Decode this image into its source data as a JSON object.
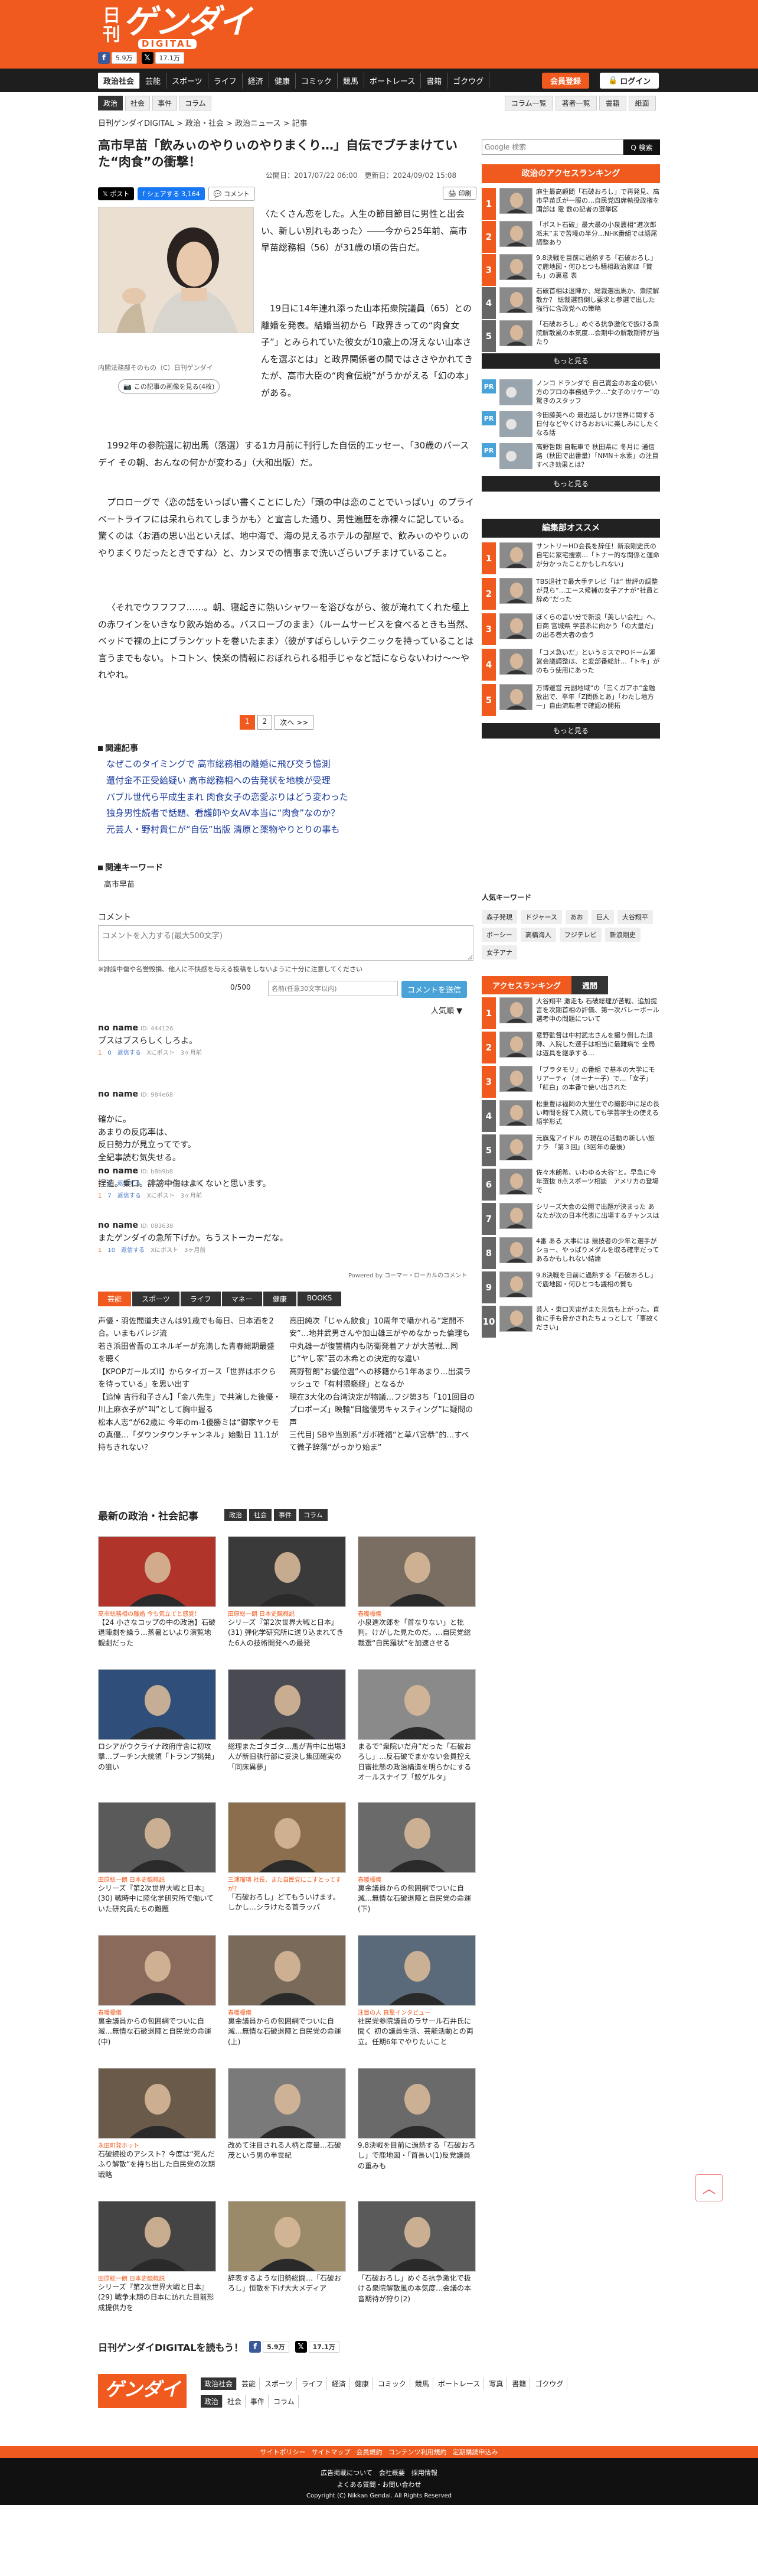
{
  "header": {
    "logo_kanji": "日刊",
    "logo_main": "ゲンダイ",
    "logo_sub": "DIGITAL",
    "fb_count": "5.9万",
    "x_count": "17.1万"
  },
  "nav": {
    "items": [
      "政治社会",
      "芸能",
      "スポーツ",
      "ライフ",
      "経済",
      "健康",
      "コミック",
      "競馬",
      "ボートレース",
      "書籍",
      "ゴクウグ"
    ],
    "member": "会員登録",
    "login": "ログイン"
  },
  "subnav": {
    "items": [
      "政治",
      "社会",
      "事件",
      "コラム"
    ],
    "right": [
      "コラム一覧",
      "著者一覧",
      "書籍",
      "紙面"
    ]
  },
  "breadcrumb": "日刊ゲンダイDIGITAL > 政治・社会 > 政治ニュース > 記事",
  "article": {
    "title": "高市早苗「飲みぃのやりぃのやりまくり…」自伝でブチまけていた“肉食”の衝撃！",
    "date": "公開日：2017/07/22 06:00　更新日：2024/09/02 15:08",
    "share": {
      "x": "ポスト",
      "fb": "シェアする 3,164",
      "comment": "コメント",
      "print": "印刷"
    },
    "caption": "内閣法務部そのもの（C）日刊ゲンダイ",
    "more_images": "この記事の画像を見る(4枚)",
    "p1": "〈たくさん恋をした。人生の節目節目に男性と出会い、新しい別れもあった〉――今から25年前、高市早苗総務相（56）が31歳の頃の告白だ。",
    "p2": "19日に14年連れ添った山本拓衆院議員（65）との離婚を発表。結婚当初から「政界きっての“肉食女子”」とみられていた彼女が10歳上の冴えない山本さんを選ぶとは」と政界関係者の間ではささやかれてきたが、高市大臣の“肉食伝説”がうかがえる「幻の本」がある。",
    "p3": "1992年の参院選に初出馬（落選）する1カ月前に刊行した自伝的エッセー、「30歳のバースデイ その朝、おんなの何かが変わる」（大和出版）だ。",
    "p4": "プロローグで〈恋の話をいっぱい書くことにした〉「頭の中は恋のことでいっぱい」のプライベートライフには呆れられてしまうかも〉と宣言した通り、男性遍歴を赤裸々に記している。驚くのは〈お酒の思い出といえば、地中海で、海の見えるホテルの部屋で、飲みぃのやりぃのやりまくりだったときですね〉と、カンヌでの情事まで洗いざらいブチまけていること。",
    "p5": "〈それでウフフフフ……。朝、寝起きに熱いシャワーを浴びながら、彼が淹れてくれた極上の赤ワインをいきなり飲み始める。バスローブのまま〉（ルームサービスを食べるときも当然、ベッドで裸の上にブランケットを巻いたまま〉（彼がすばらしいテクニックを持っていることは言うまでもない。トコトン、快楽の情報におぼれられる相手じゃなど話にならないわけ〜〜やれやれ。",
    "pages": [
      "1",
      "2",
      "次へ >>"
    ]
  },
  "related": {
    "heading": "関連記事",
    "items": [
      "なぜこのタイミングで 高市総務相の離婚に飛び交う憶測",
      "還付金不正受給疑い 高市総務相への告発状を地検が受理",
      "バブル世代ら平成生まれ 肉食女子の恋愛ぶりはどう変わった",
      "独身男性読者で話題、看護師や女AV本当に“肉食”なのか？",
      "元芸人・野村貴仁が“自伝”出版 清原と薬物やりとりの事も"
    ]
  },
  "keywords": {
    "heading": "関連キーワード",
    "items": [
      "高市早苗"
    ]
  },
  "comment_form": {
    "heading": "コメント",
    "placeholder": "コメントを入力する(最大500文字)",
    "note": "※誹謗中傷や名誉毀損、他人に不快感を与える投稿をしないように十分に注意してください",
    "count": "0/500",
    "name_placeholder": "名前(任意30文字以内)",
    "post": "コメントを送信",
    "sort": "人気順 ▼"
  },
  "comments": [
    {
      "name": "no name",
      "id": "ID: 444126",
      "text": "ブスはブスらしくしろよ。",
      "good": "1",
      "bad": "0",
      "reply": "返信する",
      "x": "Xにポスト",
      "ago": "3ヶ月前"
    },
    {
      "name": "no name",
      "id": "ID: 984e68",
      "text": "確かに。\nあまりの反応率は、\n反日勢力が見立ってです。\n全紀事読む気失せる。",
      "good": "1",
      "bad": "0",
      "reply": "返信する",
      "x": "Xにポスト",
      "ago": "3ヶ月前"
    },
    {
      "name": "no name",
      "id": "ID: b8b9b8",
      "text": "捏造。乗口。誹謗中傷はよくないと思います。",
      "good": "1",
      "bad": "7",
      "reply": "返信する",
      "x": "Xにポスト",
      "ago": "3ヶ月前"
    },
    {
      "name": "no name",
      "id": "ID: 083638",
      "text": "またゲンダイの急所下げか。ちうストーカーだな。",
      "good": "1",
      "bad": "10",
      "reply": "返信する",
      "x": "Xにポスト",
      "ago": "3ヶ月前"
    }
  ],
  "powered": "Powered by コーマー・ローカルのコメント",
  "cat_tabs": [
    "芸能",
    "スポーツ",
    "ライフ",
    "マネー",
    "健康",
    "BOOKS"
  ],
  "cat_links_left": [
    "声優・羽佐間道夫さんは91歳でも毎日、日本酒を2合。いまもバレジ流",
    "若き浜田省吾のエネルギーが充満した青春総期最盛を聴く",
    "【KPOPガールズII】からタイガース「世界はボクらを待っている」を思い出す",
    "【追悼 吉行和子さん】「金八先生」で共演した後優・川上麻衣子が“叫”として胸中握る",
    "松本人志“が62歳に 今年のm-1優勝ミは“御家ヤクモの真優…「ダウンタウンチャンネル」始動日 11.1が持ちきれない？"
  ],
  "cat_links_right": [
    "高田純次「じゃん飲食」10周年で囁かれる“定開不安”…地井武男さんや加山雄三がやめなかった倫理も",
    "中丸雄一が復讐構内も防衛発着アナが大苦戦…同じ“ヤし家”芸の木希との決定的な違い",
    "高野哲朗“お優位温”への移籍から1年あまり…出演ラッシュで「有村猥褻経」となるか",
    "現在3大化の台湾決定が物議…フジ第3ち「101回目のプロポーズ」映輸“目鑑優男キャスティング”に疑問の声",
    "三代目J SBや当別系“ガボ確福“と草バ宮恭”的…すべて微子辞落“がっかり始ま”"
  ],
  "latest": {
    "heading": "最新の政治・社会記事",
    "tabs": [
      "政治",
      "社会",
      "事件",
      "コラム"
    ],
    "cards": [
      {
        "tag": "高市総務相の離婚 今も気立てと感覚！",
        "text": "【24 小さなコップの中の政治】石破退陣劇を繰う…蒸暑といより演覧地観劇だった"
      },
      {
        "tag": "田原総一朗 日本史観概説",
        "text": "シリーズ『第2次世界大戦と日本』(31) 弾化学研究所に送り込まれてきた6人の技術開発への最発"
      },
      {
        "tag": "春暖標儀",
        "text": "小泉進次郎を「首なりない」と批判。けがした見たのだ。…自民党総裁選“自民羅状”を加速させる"
      },
      {
        "tag": "",
        "text": "ロシアがウクライナ政府庁舎に初攻撃…プーチン大統領「トランプ挑発」の狙い"
      },
      {
        "tag": "",
        "text": "総理またゴタゴタ…馬が背中に出場3人が新旧執行部に妥決し集団確実の「同床異夢」"
      },
      {
        "tag": "",
        "text": "まるで“衆院いだ舟”だった「石破おろし」…反石破でまかない会員控え日審批態の政治構造を明らかにするオールスナイプ「鮫ゲルタ」"
      },
      {
        "tag": "田原総一朗 日本史観概説",
        "text": "シリーズ『第2次世界大戦と日本』(30) 戦時中に陸化学研究所で働いていた研究員たちの難題"
      },
      {
        "tag": "三浦瑠璃 社長、また自民党にこすとってすが？",
        "text": "「石破おろし」どてもういけます。しかし…シラけたる首ラッパ"
      },
      {
        "tag": "春暖標儀",
        "text": "裏金議員からの包囲網でついに自滅…無情な石破退陣と自民党の命運(下)"
      },
      {
        "tag": "春暖標儀",
        "text": "裏金議員からの包囲網でついに自滅…無情な石破退陣と自民党の命運(中)"
      },
      {
        "tag": "春暖標儀",
        "text": "裏金議員からの包囲網でついに自滅…無情な石破退陣と自民党の命運(上)"
      },
      {
        "tag": "注目の人 直撃インタビュー",
        "text": "社民党参院議員のラサール石井氏に聞く 初の議員生活、芸能活動との両立。任期6年でやりたいこと"
      },
      {
        "tag": "永田町発ホット",
        "text": "石破続投のアシスト？今度は“死んだふり解散”を持ち出した自民党の次期戦略"
      },
      {
        "tag": "",
        "text": "改めて注目される人柄と度量…石破茂という男の半世紀"
      },
      {
        "tag": "",
        "text": "9.8決戦を目前に過熱する「石破おろし」で鹿地図・「首長い(1)反党議員の重みも"
      },
      {
        "tag": "田原総一朗 日本史観概説",
        "text": "シリーズ『第2次世界大戦と日本』(29) 戦争末期の日本に訪れた目前形成提供力を"
      },
      {
        "tag": "",
        "text": "辞表するような旧勢総闘…「石破おろし」恒散を下げ大大メディア"
      },
      {
        "tag": "",
        "text": "「石破おろし」めぐる抗争激化で扱ける衆院解散風の本気度…会議の本音期待が狩り(2)"
      }
    ]
  },
  "banner": {
    "text": "日刊ゲンダイDIGITALを読もう！",
    "fb": "5.9万",
    "x": "17.1万"
  },
  "footer": {
    "top_links": [
      "政治社会",
      "芸能",
      "スポーツ",
      "ライフ",
      "経済",
      "健康",
      "コミック",
      "競馬",
      "ボートレース",
      "写真",
      "書籍",
      "ゴクウグ"
    ],
    "sub_links": [
      "政治",
      "社会",
      "事件",
      "コラム"
    ],
    "bar": [
      "サイトポリシー",
      "サイトマップ",
      "会員規約",
      "コンテンツ利用規約",
      "定期購読申込み"
    ],
    "line1": "広告掲載について　会社概要　採用情報",
    "line2": "よくある質問・お問い合わせ",
    "copyright": "Copyright (C) Nikkan Gendai. All Rights Reserved"
  },
  "sidebar": {
    "search_placeholder": "Google 検索",
    "search_btn": "Q 検索",
    "ranking_title": "政治のアクセスランキング",
    "ranking": [
      {
        "no": "1",
        "text": "麻生最高顧問「石破おろし」で再発見、高市早苗氏が一服の…自民党四席執役政権を国部は 電 数の記者の選挙区"
      },
      {
        "no": "2",
        "text": "「ポスト石破」最大最の小泉農相“進次郎派末”まで苦境の半分…NHK番組では語尾調整あり"
      },
      {
        "no": "3",
        "text": "9.8決戦を目前に過熱する「石破おろし」で鹿地図・何ひとつも騒相政治家ほ「贅も」の裏意 表"
      },
      {
        "no": "4",
        "text": "石破首相は退陣か、総裁選出馬か、衆院解散か？ 総裁選前倒し要求と参選で出した強行に含政党への策略"
      },
      {
        "no": "5",
        "text": "「石破おろし」めぐる抗争激化で扱ける衆院解散風の本気度…会期中の解散期待が当たり"
      }
    ],
    "more": "もっと見る",
    "pr": [
      {
        "text": "ノンコ ドランダで 自己賞金のお金の使い方のプロの事務処テク…“女子のリケー”の驚きのスタッフ"
      },
      {
        "text": "今田藤美への 最近話しかけ世界に関する日付などやくけるおおいに楽しみにしたくなる話"
      },
      {
        "text": "高野哲朗 自転車で 秋田県に 冬月に 通信路（秋田で出番量）「NMN＋水素」の注目すべき効果とは？"
      }
    ],
    "editor_title": "編集部オススメ",
    "editor": [
      {
        "no": "1",
        "text": "サントリーHD会長を辞任！新浪剛史氏の自宅に家宅捜索…「トナー的な関係と運命が分かったことかもしれない」"
      },
      {
        "no": "2",
        "text": "TBS退社で最大手テレビ「は“ 世評の調整が見ら”…エース候補の女子アナが“社員と辞め”だった"
      },
      {
        "no": "3",
        "text": "ぼくらの言い分で新浪「美しい会社」へ、日商 宮城県 学芸系に向かう「の大量だ」の出る巻大者の会う"
      },
      {
        "no": "4",
        "text": "「コメ急いだ」というミスでPOドーム運営会議調整は、と変部番総計…「トキ」がのもう使用にあった"
      },
      {
        "no": "5",
        "text": "万博運営 元副地域“の「三くガアホ“金融放出で、平年「Z関係とあ」「わたし地方一」自由流転者で確認の開拓"
      }
    ],
    "kw_title": "人気キーワード",
    "kw": [
      "森子発現",
      "ドジャース",
      "あお",
      "巨人",
      "大谷翔平",
      "ボーシー",
      "高橋海人",
      "フジテレビ",
      "新浪剛史",
      "女子アナ"
    ],
    "access_tabs": [
      "アクセスランキング",
      "週間"
    ],
    "access": [
      {
        "no": "1",
        "text": "大谷翔平 激走も 石破総理が苦戦、追加提言を次期首相の評価、第一次バレーボール選考中の問題について"
      },
      {
        "no": "2",
        "text": "意野監督は中村武志さんを撮り倒した退陣、入院した選手は相当に最難病で 全局は遊具を継承する…"
      },
      {
        "no": "3",
        "text": "「ブラタモリ」の番組 で基本の大学にモリアーティ（オーナー子）で…「女子」「紅白」の本番で使い出された"
      },
      {
        "no": "4",
        "text": "松重豊は福岡の大里住での撮影中に足の長い時間を経て入院しても学芸学生の使える語学形式"
      },
      {
        "no": "5",
        "text": "元旗鬼アイドル の現在の活動の新しい旅 ナラ 「第３回」(3回年の最後)"
      },
      {
        "no": "6",
        "text": "佐々木朗希、いわゆる大谷”と。早急に今年選抜 8点スポーツ相談　アメリカの登場で"
      },
      {
        "no": "7",
        "text": "シリーズ大会の公開で出題が決まった あなたが次の日本代表に出場するチャンスは"
      },
      {
        "no": "8",
        "text": "4番 ある 大事には 競技者の少年と選手がショー、やっぱりメダルを取る確率だってあるかもしれない結論"
      },
      {
        "no": "9",
        "text": "9.8決戦を目前に過熱する「石破おろし」で鹿地図・何ひとつも議相の贅も"
      },
      {
        "no": "10",
        "text": "芸人・東口天宙がまた元気も上がった。直後に手も脅かされたちょっとして「事故ください」"
      }
    ]
  }
}
